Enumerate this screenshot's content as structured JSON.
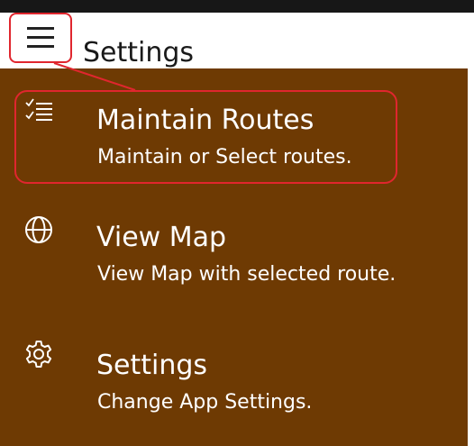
{
  "header": {
    "title": "Settings",
    "menu_icon": "hamburger-menu-icon"
  },
  "menu": {
    "items": [
      {
        "title": "Maintain Routes",
        "subtitle": "Maintain or Select routes.",
        "icon": "checklist-icon"
      },
      {
        "title": "View Map",
        "subtitle": "View Map with selected route.",
        "icon": "globe-icon"
      },
      {
        "title": "Settings",
        "subtitle": "Change App Settings.",
        "icon": "gear-icon"
      }
    ]
  },
  "colors": {
    "menu_background": "#6e3a03",
    "highlight": "#e0262e",
    "text_on_menu": "#ffffff"
  }
}
